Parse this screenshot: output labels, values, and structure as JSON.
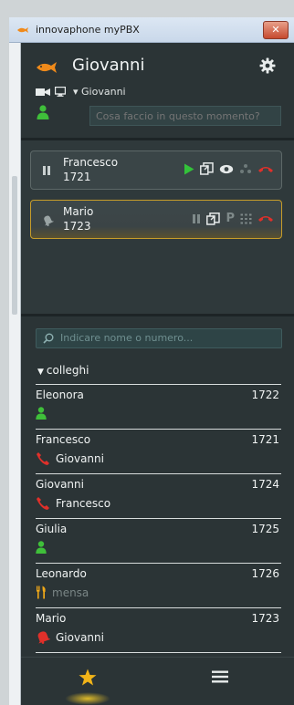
{
  "window": {
    "title": "innovaphone myPBX",
    "close_label": "✕"
  },
  "user": {
    "name": "Giovanni",
    "device_label": "Giovanni",
    "status_placeholder": "Cosa faccio in questo momento?"
  },
  "calls": [
    {
      "name": "Francesco",
      "number": "1721",
      "state": "active"
    },
    {
      "name": "Mario",
      "number": "1723",
      "state": "ringing",
      "park_label": "P"
    }
  ],
  "search": {
    "placeholder": "Indicare nome o numero..."
  },
  "group": {
    "name": "colleghi"
  },
  "contacts": [
    {
      "name": "Eleonora",
      "number": "1722",
      "status": "available",
      "sub": ""
    },
    {
      "name": "Francesco",
      "number": "1721",
      "status": "on-call",
      "sub": "Giovanni"
    },
    {
      "name": "Giovanni",
      "number": "1724",
      "status": "on-call",
      "sub": "Francesco"
    },
    {
      "name": "Giulia",
      "number": "1725",
      "status": "available",
      "sub": ""
    },
    {
      "name": "Leonardo",
      "number": "1726",
      "status": "away-lunch",
      "sub": "mensa"
    },
    {
      "name": "Mario",
      "number": "1723",
      "status": "ringing",
      "sub": "Giovanni"
    }
  ],
  "colors": {
    "background": "#2b3436",
    "available": "#3fbf3a",
    "call_red": "#e0302a",
    "highlight": "#c69c2a",
    "play_green": "#33c23a"
  },
  "icons": {
    "favorites": "star-icon",
    "menu": "hamburger-icon",
    "settings": "gear-icon"
  }
}
